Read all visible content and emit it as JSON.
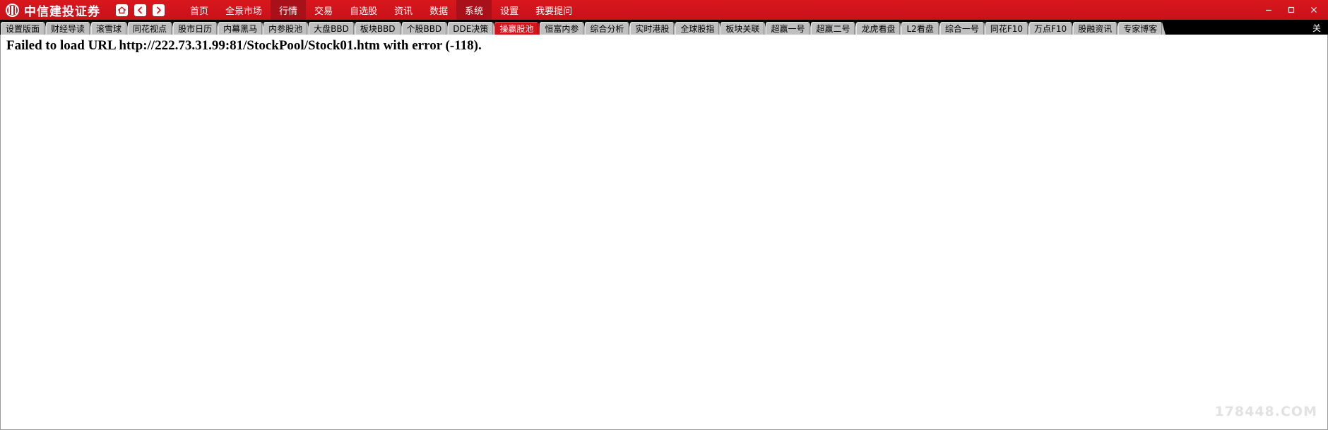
{
  "window": {
    "brand_name": "中信建投证券",
    "logo_icon": "cicc-circle-logo",
    "quick_buttons": [
      {
        "name": "home-icon",
        "glyph": "⌂"
      },
      {
        "name": "back-icon",
        "glyph": "‹"
      },
      {
        "name": "forward-icon",
        "glyph": "›"
      }
    ],
    "controls": [
      {
        "name": "minimize-button",
        "glyph": "—"
      },
      {
        "name": "maximize-button",
        "glyph": "▢"
      },
      {
        "name": "close-button",
        "glyph": "✕"
      }
    ]
  },
  "mainnav": {
    "items": [
      {
        "label": "首页",
        "active": false
      },
      {
        "label": "全景市场",
        "active": false
      },
      {
        "label": "行情",
        "active": true
      },
      {
        "label": "交易",
        "active": false
      },
      {
        "label": "自选股",
        "active": false
      },
      {
        "label": "资讯",
        "active": false
      },
      {
        "label": "数据",
        "active": false
      },
      {
        "label": "系统",
        "active": true
      },
      {
        "label": "设置",
        "active": false
      },
      {
        "label": "我要提问",
        "active": false
      }
    ]
  },
  "tabstrip": {
    "close_label": "关",
    "tabs": [
      {
        "label": "设置版面",
        "active": false
      },
      {
        "label": "财经导读",
        "active": false
      },
      {
        "label": "滚雪球",
        "active": false
      },
      {
        "label": "同花视点",
        "active": false
      },
      {
        "label": "股市日历",
        "active": false
      },
      {
        "label": "内幕黑马",
        "active": false
      },
      {
        "label": "内参股池",
        "active": false
      },
      {
        "label": "大盘BBD",
        "active": false
      },
      {
        "label": "板块BBD",
        "active": false
      },
      {
        "label": "个股BBD",
        "active": false
      },
      {
        "label": "DDE决策",
        "active": false
      },
      {
        "label": "操赢股池",
        "active": true
      },
      {
        "label": "恒富内参",
        "active": false
      },
      {
        "label": "综合分析",
        "active": false
      },
      {
        "label": "实时港股",
        "active": false
      },
      {
        "label": "全球股指",
        "active": false
      },
      {
        "label": "板块关联",
        "active": false
      },
      {
        "label": "超赢一号",
        "active": false
      },
      {
        "label": "超赢二号",
        "active": false
      },
      {
        "label": "龙虎看盘",
        "active": false
      },
      {
        "label": "L2看盘",
        "active": false
      },
      {
        "label": "综合一号",
        "active": false
      },
      {
        "label": "同花F10",
        "active": false
      },
      {
        "label": "万点F10",
        "active": false
      },
      {
        "label": "股融资讯",
        "active": false
      },
      {
        "label": "专家博客",
        "active": false
      }
    ]
  },
  "content": {
    "error_message": "Failed to load URL http://222.73.31.99:81/StockPool/Stock01.htm with error (-118).",
    "watermark": "178448.COM"
  },
  "colors": {
    "header_red": "#d4141b",
    "header_red_active": "#a8101a",
    "tab_gray": "#c0c0c0",
    "tabstrip_bg": "#000000",
    "watermark_gray": "#e2e2e2"
  }
}
